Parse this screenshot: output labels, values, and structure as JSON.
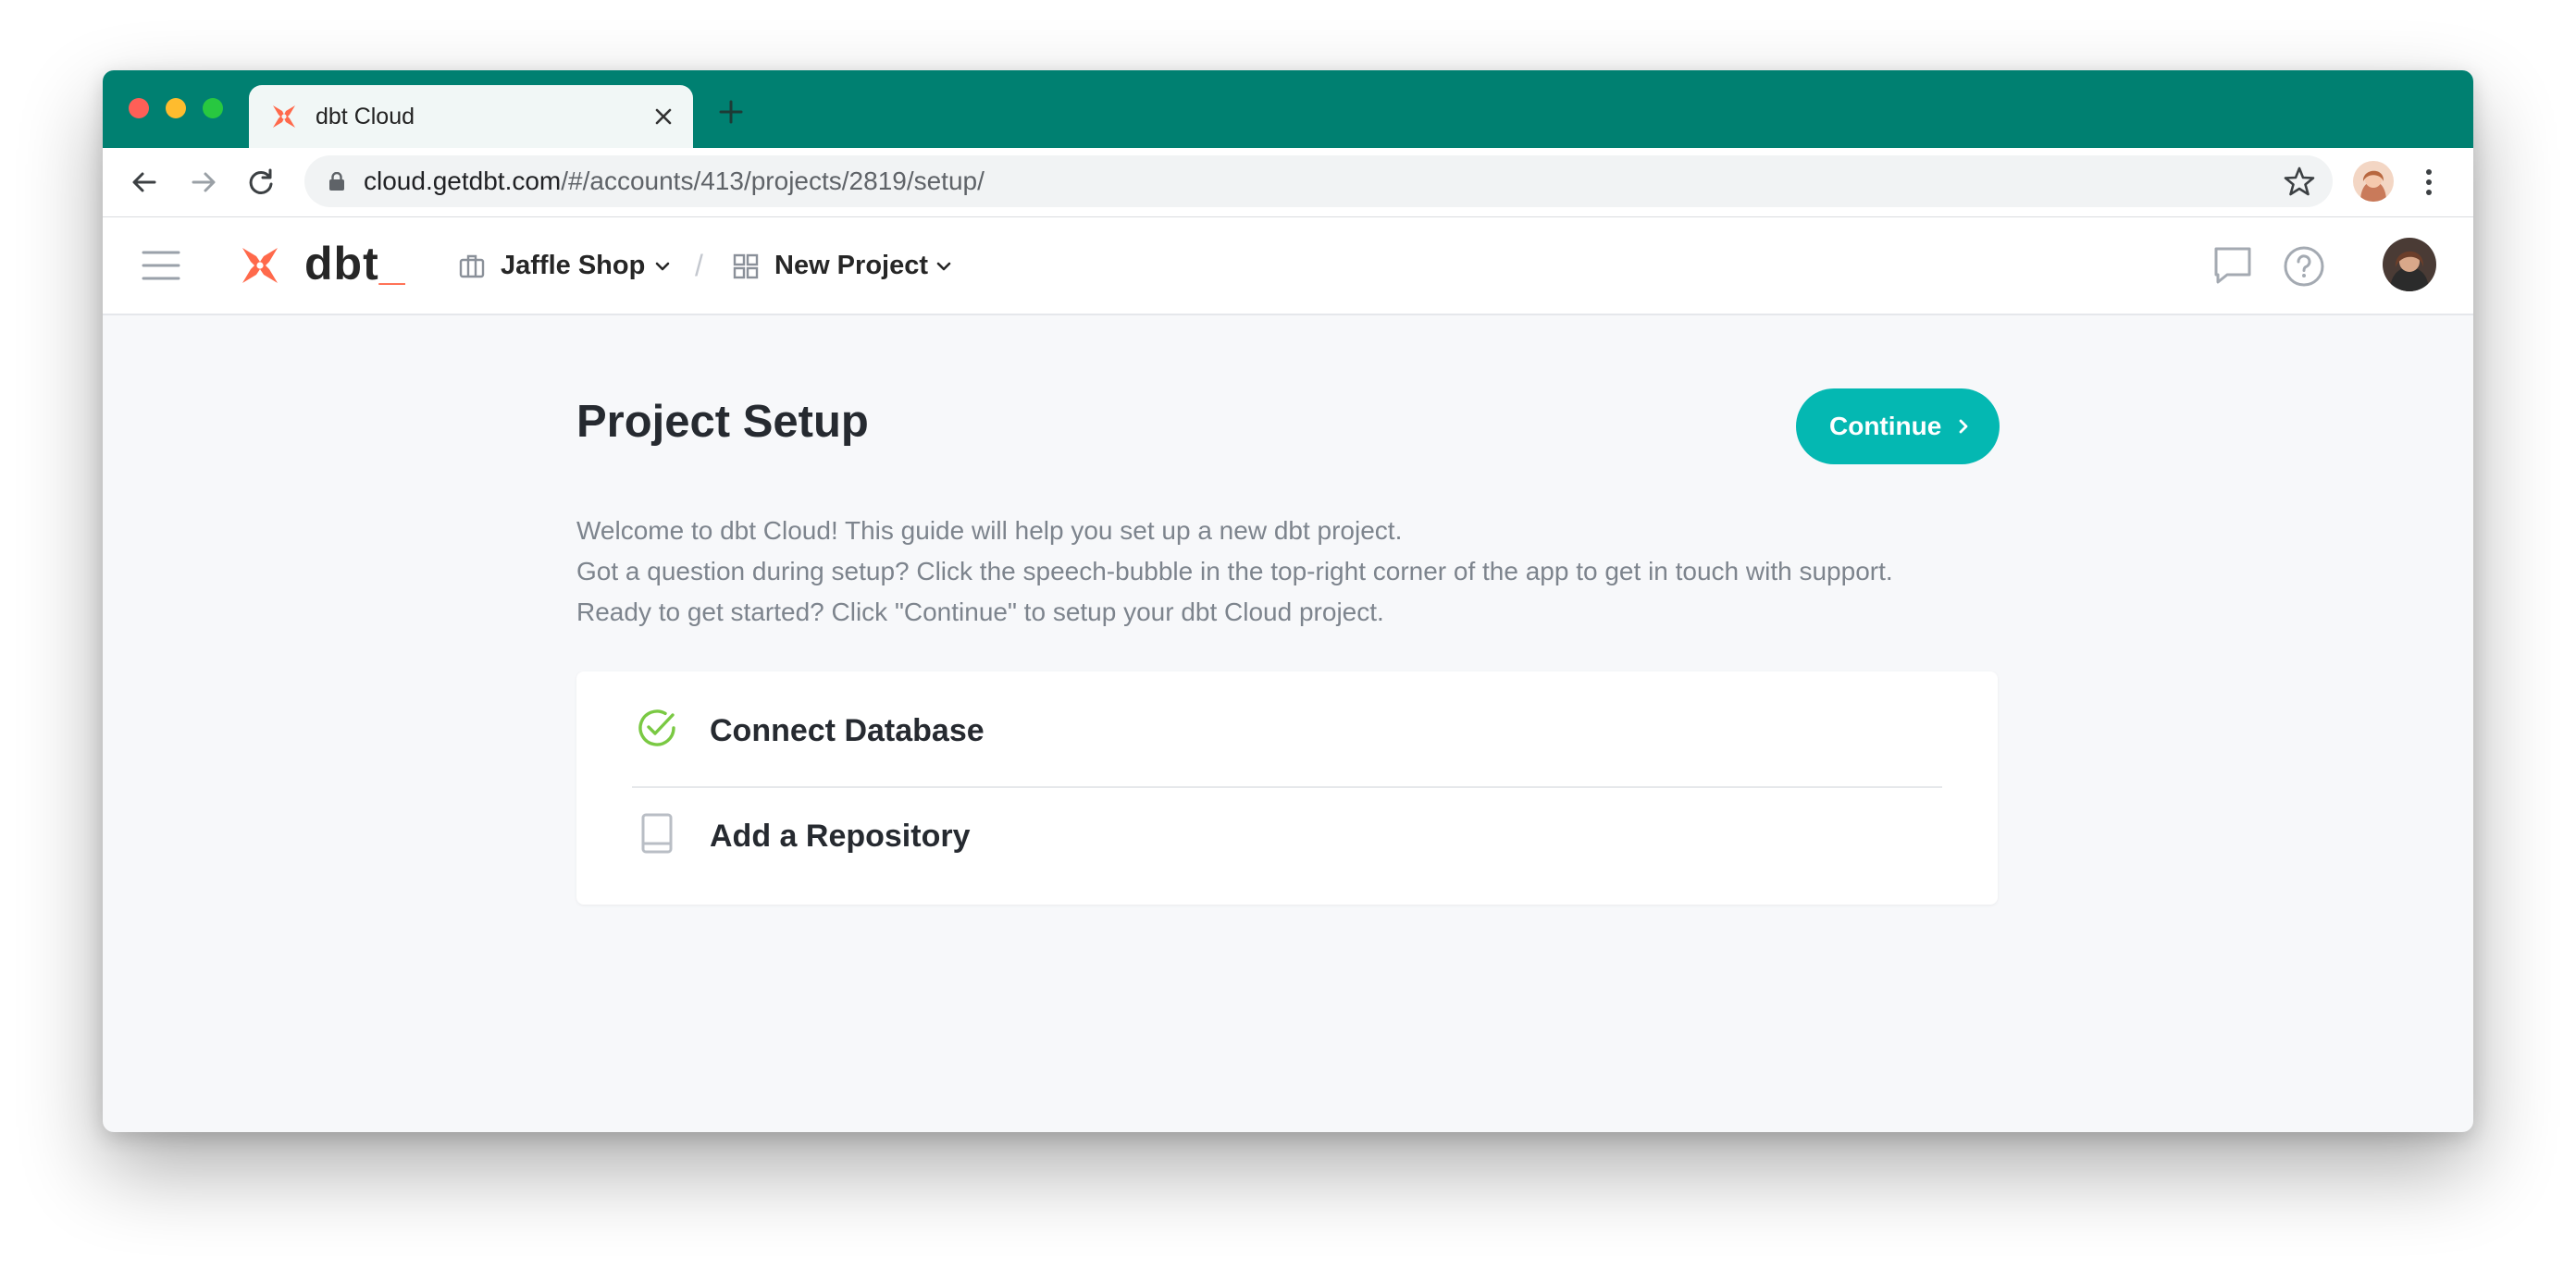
{
  "browser": {
    "tab_title": "dbt Cloud",
    "url_host": "cloud.getdbt.com",
    "url_path": "/#/accounts/413/projects/2819/setup/"
  },
  "app_nav": {
    "logo_text": "dbt",
    "logo_suffix": "_",
    "account": "Jaffle Shop",
    "separator": "/",
    "project": "New Project"
  },
  "page": {
    "title": "Project Setup",
    "continue_label": "Continue",
    "intro_lines": [
      "Welcome to dbt Cloud! This guide will help you set up a new dbt project.",
      "Got a question during setup? Click the speech-bubble in the top-right corner of the app to get in touch with support.",
      "Ready to get started? Click \"Continue\" to setup your dbt Cloud project."
    ]
  },
  "steps": [
    {
      "label": "Connect Database",
      "status": "complete",
      "icon": "check-circle-icon"
    },
    {
      "label": "Add a Repository",
      "status": "pending",
      "icon": "book-icon"
    }
  ],
  "colors": {
    "tab_bar": "#008071",
    "accent": "#04b8b2",
    "brand": "#ff694b",
    "success": "#7ac943"
  }
}
